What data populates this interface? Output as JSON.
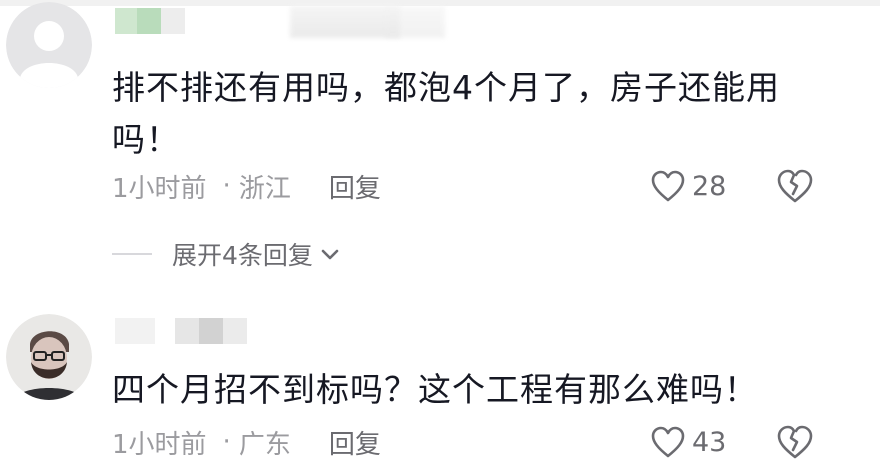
{
  "comments": [
    {
      "avatar_icon": "default-avatar-icon",
      "text": "排不排还有用吗，都泡4个月了，房子还能用吗！",
      "time": "1小时前",
      "dot": "·",
      "location": "浙江",
      "reply_label": "回复",
      "like_icon": "heart-outline-icon",
      "like_count": "28",
      "dislike_icon": "broken-heart-icon",
      "expand_replies_label": "展开4条回复",
      "expand_icon": "chevron-down-icon"
    },
    {
      "avatar_icon": "bearded-man-avatar-icon",
      "text": "四个月招不到标吗？这个工程有那么难吗！",
      "time": "1小时前",
      "dot": "·",
      "location": "广东",
      "reply_label": "回复",
      "like_icon": "heart-outline-icon",
      "like_count": "43",
      "dislike_icon": "broken-heart-icon"
    }
  ],
  "colors": {
    "text_primary": "#161823",
    "text_secondary": "#9b9b9f",
    "text_action": "#6b6b70",
    "icon_stroke": "#6b6b70",
    "avatar_default_bg": "#e5e5e7",
    "avatar_default_fg": "#ffffff"
  }
}
